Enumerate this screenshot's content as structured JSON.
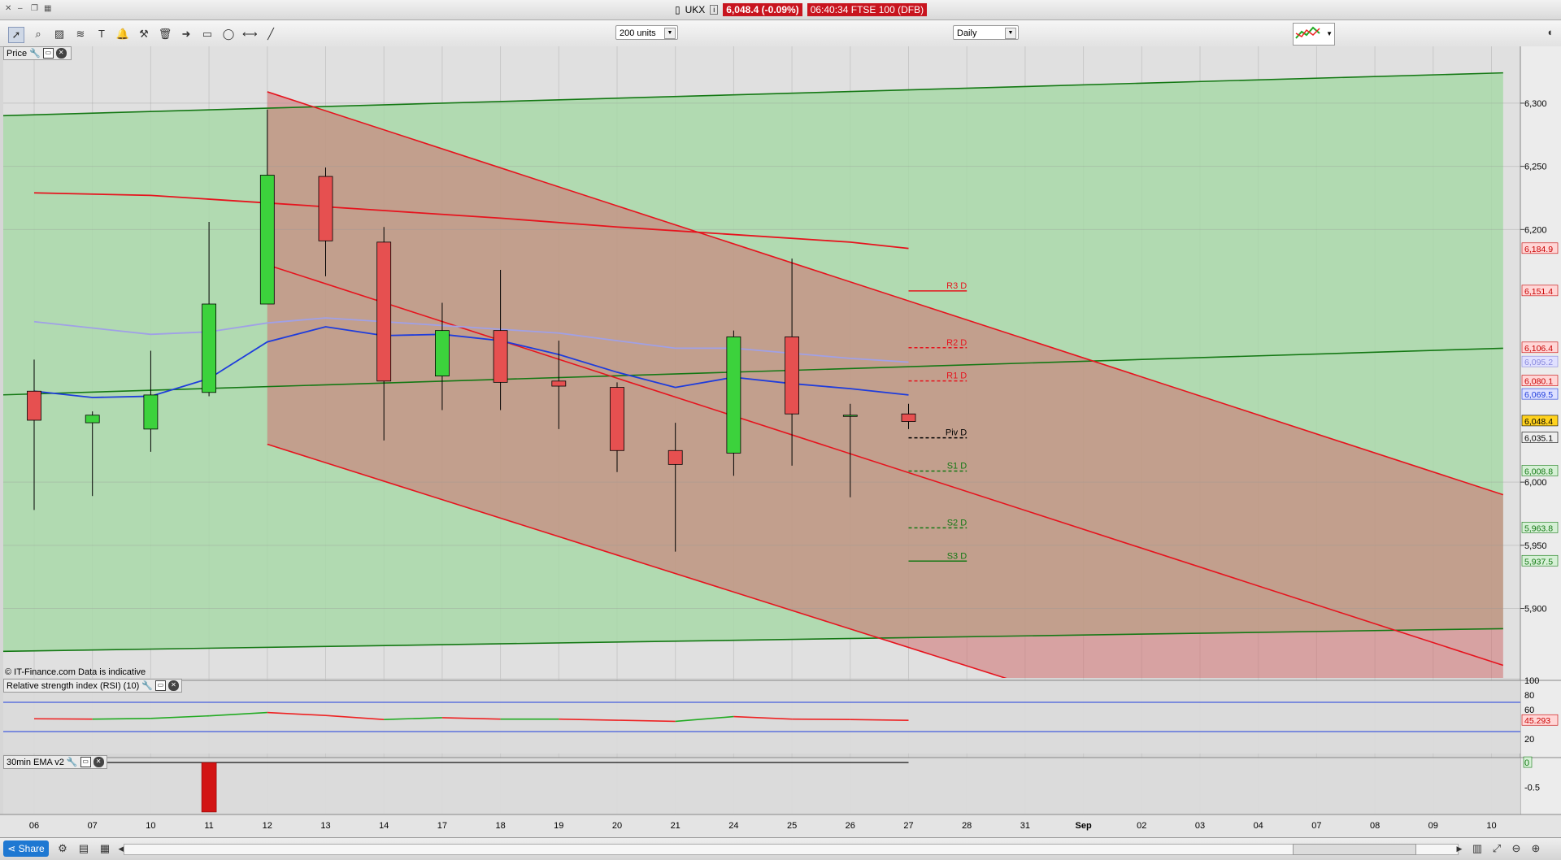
{
  "window": {
    "symbol": "UKX",
    "price_badge": "6,048.4 (-0.09%)",
    "time_label": "06:40:34 FTSE 100 (DFB)"
  },
  "toolbar": {
    "units_value": "200 units",
    "interval_value": "Daily"
  },
  "panels": {
    "price_label": "Price",
    "rsi_label": "Relative strength index (RSI) (10)",
    "ema_label": "30min EMA v2",
    "watermark": "© IT-Finance.com  Data is indicative"
  },
  "share_label": "Share",
  "chart_data": [
    {
      "type": "candlestick",
      "categories": [
        "06",
        "07",
        "10",
        "11",
        "12",
        "13",
        "14",
        "17",
        "18",
        "19",
        "20",
        "21",
        "24",
        "25",
        "26",
        "27",
        "28",
        "31",
        "Sep",
        "02",
        "03",
        "04",
        "07",
        "08",
        "09",
        "10"
      ],
      "candles": [
        {
          "date": "06",
          "open": 6072,
          "high": 6097,
          "low": 5978,
          "close": 6049
        },
        {
          "date": "07",
          "open": 6047,
          "high": 6056,
          "low": 5989,
          "close": 6053
        },
        {
          "date": "10",
          "open": 6042,
          "high": 6104,
          "low": 6024,
          "close": 6069
        },
        {
          "date": "11",
          "open": 6071,
          "high": 6206,
          "low": 6068,
          "close": 6141
        },
        {
          "date": "12",
          "open": 6141,
          "high": 6295,
          "low": 6141,
          "close": 6243
        },
        {
          "date": "13",
          "open": 6242,
          "high": 6249,
          "low": 6163,
          "close": 6191
        },
        {
          "date": "14",
          "open": 6190,
          "high": 6202,
          "low": 6033,
          "close": 6080
        },
        {
          "date": "17",
          "open": 6084,
          "high": 6142,
          "low": 6057,
          "close": 6120
        },
        {
          "date": "18",
          "open": 6120,
          "high": 6168,
          "low": 6057,
          "close": 6079
        },
        {
          "date": "19",
          "open": 6080,
          "high": 6112,
          "low": 6042,
          "close": 6076
        },
        {
          "date": "20",
          "open": 6075,
          "high": 6079,
          "low": 6008,
          "close": 6025
        },
        {
          "date": "21",
          "open": 6025,
          "high": 6047,
          "low": 5945,
          "close": 6014
        },
        {
          "date": "24",
          "open": 6023,
          "high": 6120,
          "low": 6005,
          "close": 6115
        },
        {
          "date": "25",
          "open": 6115,
          "high": 6177,
          "low": 6013,
          "close": 6054
        },
        {
          "date": "26",
          "open": 6053,
          "high": 6062,
          "low": 5988,
          "close": 6053
        },
        {
          "date": "27",
          "open": 6054,
          "high": 6062,
          "low": 6042,
          "close": 6048
        }
      ],
      "moving_averages": [
        {
          "color": "#1e3cdc",
          "points": [
            [
              0,
              6072
            ],
            [
              1,
              6067
            ],
            [
              2,
              6068
            ],
            [
              3,
              6082
            ],
            [
              4,
              6111
            ],
            [
              5,
              6123
            ],
            [
              6,
              6116
            ],
            [
              7,
              6117
            ],
            [
              8,
              6112
            ],
            [
              9,
              6101
            ],
            [
              10,
              6087
            ],
            [
              11,
              6075
            ],
            [
              12,
              6083
            ],
            [
              13,
              6078
            ],
            [
              14,
              6074
            ],
            [
              15,
              6069
            ]
          ]
        },
        {
          "color": "#a0a0e6",
          "points": [
            [
              0,
              6127
            ],
            [
              1,
              6122
            ],
            [
              2,
              6117
            ],
            [
              3,
              6119
            ],
            [
              4,
              6126
            ],
            [
              5,
              6130
            ],
            [
              6,
              6127
            ],
            [
              7,
              6124
            ],
            [
              8,
              6121
            ],
            [
              9,
              6118
            ],
            [
              10,
              6112
            ],
            [
              11,
              6106
            ],
            [
              12,
              6106
            ],
            [
              13,
              6102
            ],
            [
              14,
              6098
            ],
            [
              15,
              6095
            ]
          ]
        },
        {
          "color": "#e6141e",
          "points": [
            [
              0,
              6229
            ],
            [
              2,
              6227
            ],
            [
              4,
              6221
            ],
            [
              6,
              6215
            ],
            [
              8,
              6209
            ],
            [
              10,
              6202
            ],
            [
              12,
              6196
            ],
            [
              14,
              6190
            ],
            [
              15,
              6185
            ]
          ]
        }
      ],
      "trend_channels": [
        {
          "color": "#147814",
          "fill": "#a8d8a8",
          "upper": [
            [
              0,
              6290
            ],
            [
              26,
              6324
            ]
          ],
          "lower": [
            [
              0,
              5866
            ],
            [
              26,
              5884
            ]
          ],
          "middle": [
            [
              0,
              6069
            ],
            [
              26,
              6106
            ]
          ]
        },
        {
          "color": "#e6141e",
          "fill": "#d07070",
          "upper": [
            [
              4,
              6309
            ],
            [
              26,
              5990
            ]
          ],
          "lower": [
            [
              4,
              6030
            ],
            [
              26,
              5720
            ]
          ],
          "middle": [
            [
              4,
              6172
            ],
            [
              26,
              5855
            ]
          ]
        }
      ],
      "pivots": [
        {
          "label": "R3 D",
          "value": 6151.4,
          "color": "#e6141e",
          "dash": false
        },
        {
          "label": "R2 D",
          "value": 6106.4,
          "color": "#e6141e",
          "dash": true
        },
        {
          "label": "R1 D",
          "value": 6080.1,
          "color": "#e6141e",
          "dash": true
        },
        {
          "label": "Piv D",
          "value": 6035.1,
          "color": "#000000",
          "dash": true
        },
        {
          "label": "S1 D",
          "value": 6008.8,
          "color": "#147814",
          "dash": true
        },
        {
          "label": "S2 D",
          "value": 5963.8,
          "color": "#147814",
          "dash": true
        },
        {
          "label": "S3 D",
          "value": 5937.5,
          "color": "#147814",
          "dash": false
        }
      ],
      "yaxis_ticks": [
        "6,300",
        "6,250",
        "6,200",
        "6,000",
        "5,950",
        "5,900"
      ],
      "ylim": [
        5845,
        6345
      ],
      "price_tags": [
        {
          "label": "6,184.9",
          "value": 6184.9,
          "bg": "#ffd6d6",
          "fg": "#c80000"
        },
        {
          "label": "6,151.4",
          "value": 6151.4,
          "bg": "#ffd6d6",
          "fg": "#c80000"
        },
        {
          "label": "6,106.4",
          "value": 6106.4,
          "bg": "#ffd6d6",
          "fg": "#c80000"
        },
        {
          "label": "6,095.2",
          "value": 6095.2,
          "bg": "#e0e0ff",
          "fg": "#8888dd"
        },
        {
          "label": "6,080.1",
          "value": 6080.1,
          "bg": "#ffd6d6",
          "fg": "#c80000"
        },
        {
          "label": "6,069.5",
          "value": 6069.5,
          "bg": "#dde0ff",
          "fg": "#1e3cdc"
        },
        {
          "label": "6,048.4",
          "value": 6048.4,
          "bg": "#ffd21e",
          "fg": "#000000"
        },
        {
          "label": "6,035.1",
          "value": 6035.1,
          "bg": "#eeeeee",
          "fg": "#000000"
        },
        {
          "label": "6,008.8",
          "value": 6008.8,
          "bg": "#d6f0d6",
          "fg": "#147814"
        },
        {
          "label": "5,963.8",
          "value": 5963.8,
          "bg": "#d6f0d6",
          "fg": "#147814"
        },
        {
          "label": "5,937.5",
          "value": 5937.5,
          "bg": "#d6f0d6",
          "fg": "#147814"
        }
      ]
    },
    {
      "type": "line",
      "name": "Relative strength index (RSI) (10)",
      "values": [
        47.5,
        47.0,
        48.0,
        51.5,
        56.0,
        52.0,
        46.5,
        49.0,
        47.0,
        47.0,
        45.5,
        44.0,
        50.5,
        47.0,
        46.5,
        45.293
      ],
      "ylim": [
        0,
        100
      ],
      "yaxis_ticks": [
        "100",
        "80",
        "60",
        "20"
      ],
      "levels": [
        70,
        30
      ],
      "last_label": "45.293"
    },
    {
      "type": "bar",
      "name": "30min EMA v2",
      "bars": [
        {
          "x": 3,
          "value": -1.0
        }
      ],
      "ylim": [
        -1.05,
        0.1
      ],
      "yaxis_ticks": [
        "0",
        "-0.5"
      ]
    }
  ]
}
